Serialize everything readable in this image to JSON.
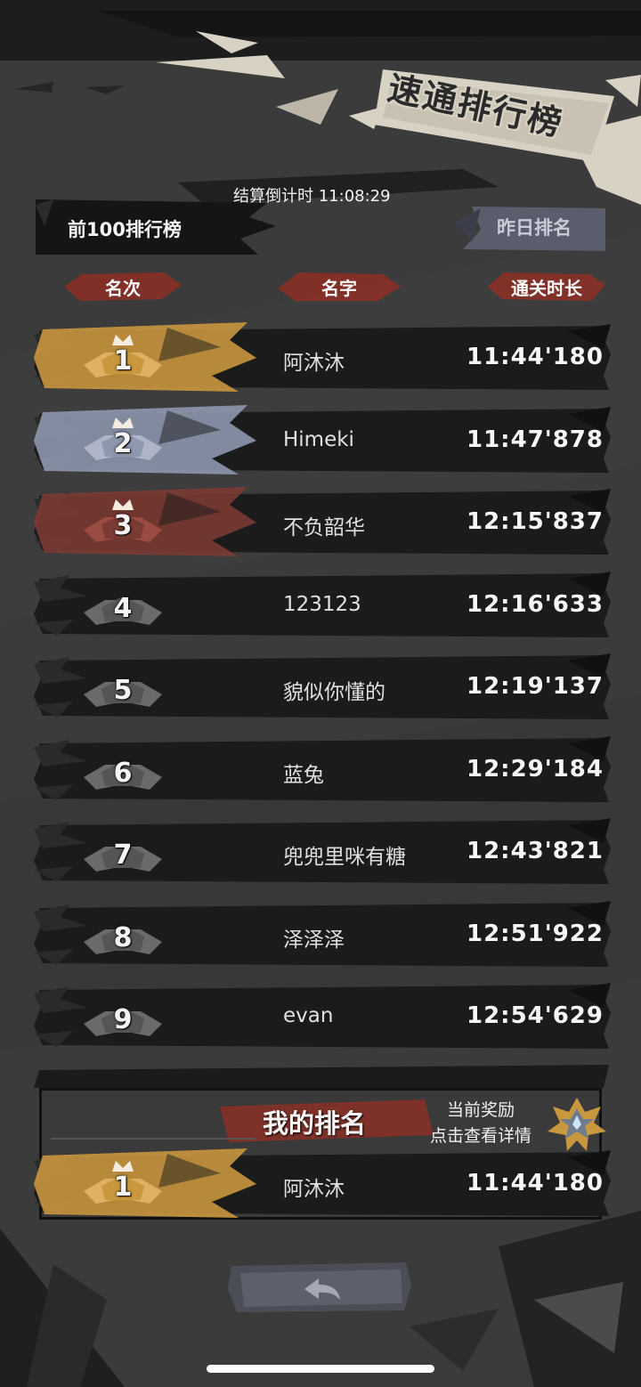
{
  "page_title": "速通排行榜",
  "countdown": "结算倒计时 11:08:29",
  "board": {
    "title": "前100排行榜",
    "yesterday_button": "昨日排名"
  },
  "columns": {
    "rank": "名次",
    "name": "名字",
    "time": "通关时长"
  },
  "rows": [
    {
      "rank": "1",
      "name": "阿沐沐",
      "time": "11:44'180",
      "tier": "gold"
    },
    {
      "rank": "2",
      "name": "Himeki",
      "time": "11:47'878",
      "tier": "silver"
    },
    {
      "rank": "3",
      "name": "不负韶华",
      "time": "12:15'837",
      "tier": "bronze"
    },
    {
      "rank": "4",
      "name": "123123",
      "time": "12:16'633",
      "tier": "normal"
    },
    {
      "rank": "5",
      "name": "貌似你懂的",
      "time": "12:19'137",
      "tier": "normal"
    },
    {
      "rank": "6",
      "name": "蓝兔",
      "time": "12:29'184",
      "tier": "normal"
    },
    {
      "rank": "7",
      "name": "兜兜里咪有糖",
      "time": "12:43'821",
      "tier": "normal"
    },
    {
      "rank": "8",
      "name": "泽泽泽",
      "time": "12:51'922",
      "tier": "normal"
    },
    {
      "rank": "9",
      "name": "evan",
      "time": "12:54'629",
      "tier": "normal"
    }
  ],
  "my_rank": {
    "title": "我的排名",
    "reward_line1": "当前奖励",
    "reward_line2": "点击查看详情",
    "rank": "1",
    "name": "阿沐沐",
    "time": "11:44'180"
  },
  "colors": {
    "background": "#3c3c3c",
    "row": "#1c1c1c",
    "gold": "#c8973e",
    "silver": "#8d97ad",
    "bronze": "#7a3b34",
    "accent_red": "#a33a2c",
    "title_paper": "#d8d2c4"
  },
  "icons": {
    "back": "back-arrow-icon",
    "reward": "reward-medal-icon",
    "crown": "crown-icon"
  }
}
